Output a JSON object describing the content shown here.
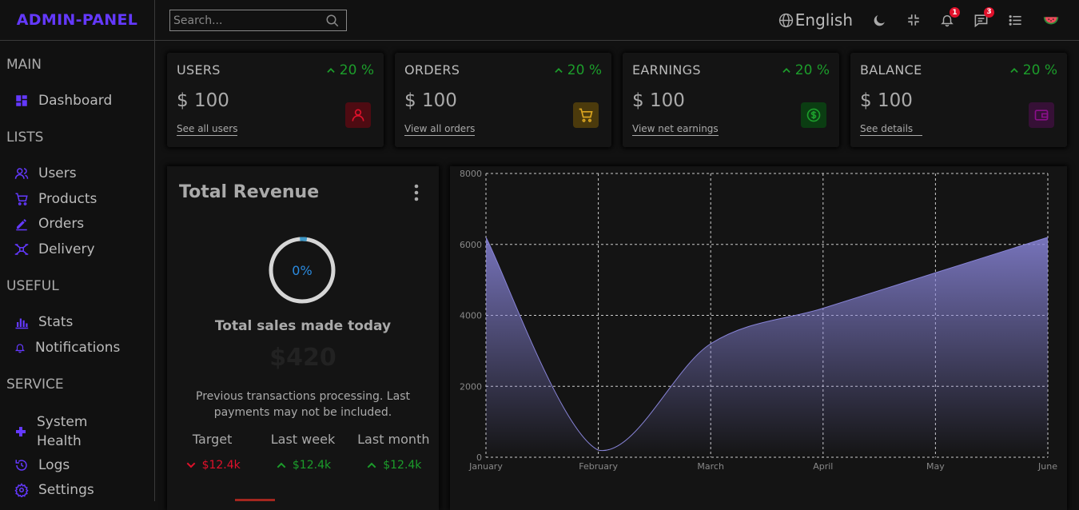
{
  "app": {
    "logo": "ADMIN-PANEL"
  },
  "search": {
    "placeholder": "Search..."
  },
  "topbar": {
    "language": "English",
    "notifications_count": "1",
    "messages_count": "3"
  },
  "sidebar": {
    "sections": [
      {
        "title": "MAIN",
        "items": [
          {
            "label": "Dashboard",
            "icon": "dashboard-icon"
          }
        ]
      },
      {
        "title": "LISTS",
        "items": [
          {
            "label": "Users",
            "icon": "users-icon"
          },
          {
            "label": "Products",
            "icon": "cart-icon"
          },
          {
            "label": "Orders",
            "icon": "pen-icon"
          },
          {
            "label": "Delivery",
            "icon": "drone-icon"
          }
        ]
      },
      {
        "title": "USEFUL",
        "items": [
          {
            "label": "Stats",
            "icon": "bar-chart-icon"
          },
          {
            "label": "Notifications",
            "icon": "bell-icon"
          }
        ]
      },
      {
        "title": "SERVICE",
        "items": [
          {
            "label": "System Health",
            "icon": "plus-icon"
          },
          {
            "label": "Logs",
            "icon": "logs-icon"
          },
          {
            "label": "Settings",
            "icon": "gear-icon"
          }
        ]
      }
    ]
  },
  "cards": [
    {
      "title": "USERS",
      "pct": "20 %",
      "amount": "$ 100",
      "link": "See all users",
      "icon": "user-icon",
      "icon_color": "#e0112b",
      "icon_bg": "#4e0b12"
    },
    {
      "title": "ORDERS",
      "pct": "20 %",
      "amount": "$ 100",
      "link": "View all orders",
      "icon": "shopping-cart-icon",
      "icon_color": "#daa520",
      "icon_bg": "#4b3a0c"
    },
    {
      "title": "EARNINGS",
      "pct": "20 %",
      "amount": "$ 100",
      "link": "View net earnings",
      "icon": "dollar-icon",
      "icon_color": "#1c9d2b",
      "icon_bg": "#0b3d12"
    },
    {
      "title": "BALANCE",
      "pct": "20 %",
      "amount": "$ 100",
      "link": "See details",
      "icon": "wallet-icon",
      "icon_color": "#8a0f8a",
      "icon_bg": "#361036"
    }
  ],
  "revenue": {
    "title": "Total Revenue",
    "progress": "0%",
    "progress_value": 0,
    "subtitle": "Total sales made today",
    "amount": "$420",
    "description": "Previous transactions processing. Last payments may not be included.",
    "stats": [
      {
        "label": "Target",
        "value": "$12.4k",
        "trend": "down"
      },
      {
        "label": "Last week",
        "value": "$12.4k",
        "trend": "up"
      },
      {
        "label": "Last month",
        "value": "$12.4k",
        "trend": "up"
      }
    ]
  },
  "chart_data": {
    "type": "area",
    "categories": [
      "January",
      "February",
      "March",
      "April",
      "May",
      "June"
    ],
    "series": [
      {
        "values": [
          6200,
          200,
          3200,
          4200,
          5200,
          6200
        ]
      }
    ],
    "ylim": [
      0,
      8000
    ],
    "yticks": [
      0,
      2000,
      4000,
      6000,
      8000
    ],
    "grid": true,
    "fill_color": "#8884d8",
    "stroke_color": "#8884d8"
  }
}
